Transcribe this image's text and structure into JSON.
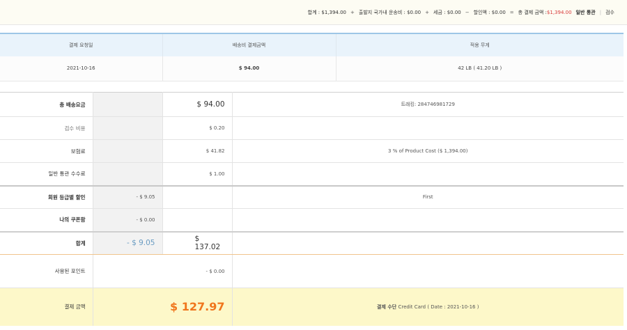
{
  "summary": {
    "sum_label": "합계 : $1,394.00",
    "plus1": "+",
    "domestic_shipping": "출발지 국가내 운송비 : $0.00",
    "plus2": "+",
    "tax": "세금 : $0.00",
    "minus": "−",
    "discount": "할인액 : $0.00",
    "equals": "=",
    "total_label": "총 결제 금액 : ",
    "total_value": "$1,394.00",
    "general_customs": "일반 통관",
    "sep": "|",
    "inspection": "검수"
  },
  "info": {
    "headers": [
      "결제 요청일",
      "배송비 결제금액",
      "적용 무게"
    ],
    "row": [
      "2021-10-16",
      "$ 94.00",
      "42 LB ( 41.20 LB )"
    ]
  },
  "costs": {
    "shipping_total": {
      "label": "총 배송요금",
      "amount": "$ 94.00",
      "note": "트래킹: 284746981729"
    },
    "inspection_fee": {
      "label": "검수 비용",
      "amount": "$ 0.20"
    },
    "insurance": {
      "label": "보험료",
      "amount": "$ 41.82",
      "note": "3 % of Product Cost ($ 1,394.00)"
    },
    "customs_fee": {
      "label": "일반 통관 수수료",
      "amount": "$ 1.00"
    },
    "member_discount": {
      "label": "회원 등급별 할인",
      "discount": "- $ 9.05",
      "note": "First"
    },
    "coupon": {
      "label": "나의 쿠폰함",
      "discount": "- $ 0.00"
    },
    "subtotal": {
      "label": "합계",
      "discount": "- $ 9.05",
      "amount": "$ 137.02"
    },
    "points": {
      "label": "사용된 포인트",
      "amount": "- $ 0.00"
    },
    "payment": {
      "label": "결제 금액",
      "amount": "$ 127.97",
      "method_label": "결제 수단",
      "method_value": "Credit Card ( Date : 2021-10-16 )"
    }
  },
  "colors": {
    "accent_red": "#d83a3a",
    "header_blue": "#e9f3fb",
    "payment_yellow": "#fdf8c9",
    "payment_orange": "#f0761d",
    "discount_blue": "#6a9cc2"
  }
}
